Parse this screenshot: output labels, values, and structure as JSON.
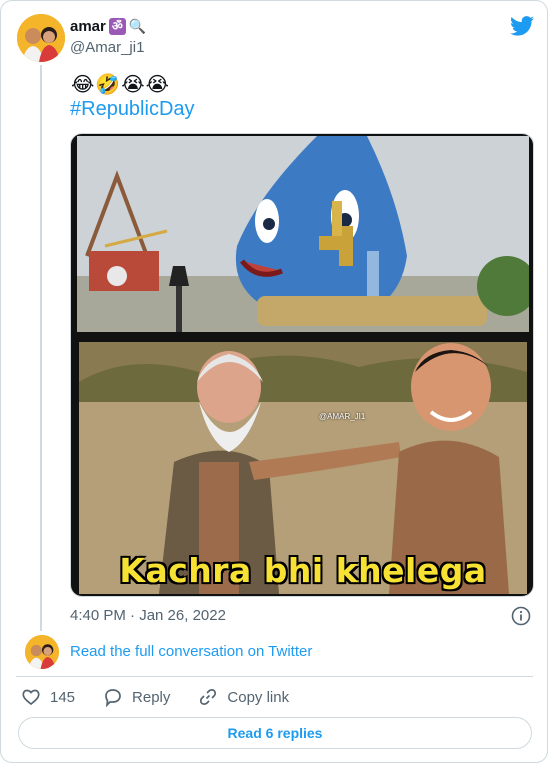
{
  "tweet": {
    "author_name": "amar",
    "name_badges": [
      "ॐ",
      "🔍"
    ],
    "handle": "@Amar_ji1",
    "emojis": "😂🤣😭😭",
    "hashtag": "#RepublicDay",
    "timestamp": "4:40 PM · Jan 26, 2022",
    "media": {
      "caption": "Kachra bhi khelega",
      "watermark": "@AMAR_JI1"
    }
  },
  "footer": {
    "read_full": "Read the full conversation on Twitter",
    "like_count": "145",
    "reply_label": "Reply",
    "copy_label": "Copy link",
    "read_replies": "Read 6 replies"
  },
  "colors": {
    "accent": "#1d9bf0",
    "muted": "#536471",
    "border": "#cfd9de"
  },
  "icons": [
    "twitter-bird-icon",
    "info-icon",
    "heart-icon",
    "reply-bubble-icon",
    "link-icon"
  ]
}
